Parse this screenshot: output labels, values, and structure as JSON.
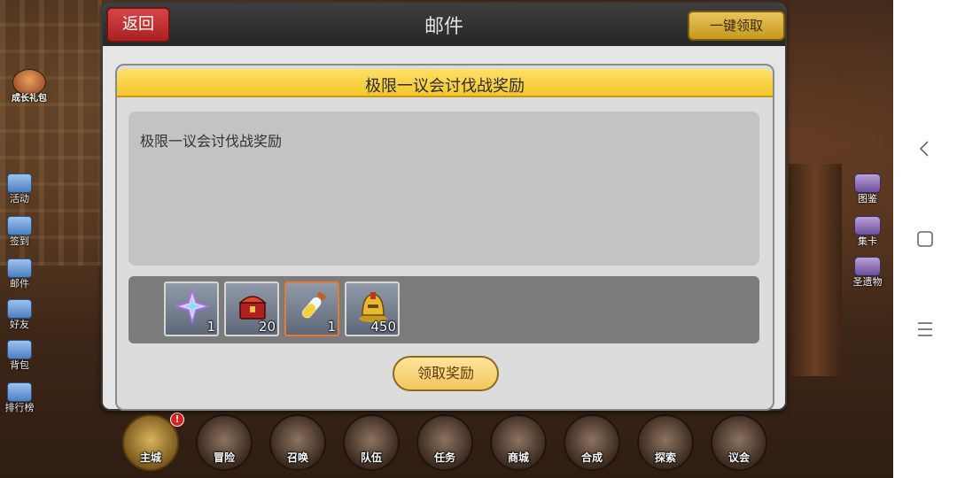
{
  "mail": {
    "title": "邮件",
    "back_label": "返回",
    "claim_all_label": "一键领取",
    "detail": {
      "title": "极限一议会讨伐战奖励",
      "body": "极限一议会讨伐战奖励",
      "rewards": [
        {
          "icon": "star-crystal-icon",
          "quantity": "1"
        },
        {
          "icon": "treasure-chest-icon",
          "quantity": "20"
        },
        {
          "icon": "potion-vial-icon",
          "quantity": "1"
        },
        {
          "icon": "gold-helmet-icon",
          "quantity": "450"
        }
      ],
      "claim_label": "领取奖励"
    }
  },
  "left_menu": {
    "growth_pack": "成长礼包",
    "items": [
      {
        "label": "活动",
        "icon": "flag-icon"
      },
      {
        "label": "签到",
        "icon": "calendar-check-icon"
      },
      {
        "label": "邮件",
        "icon": "envelope-icon"
      },
      {
        "label": "好友",
        "icon": "friends-icon"
      },
      {
        "label": "背包",
        "icon": "backpack-icon"
      },
      {
        "label": "排行榜",
        "icon": "bar-chart-icon"
      }
    ]
  },
  "right_menu": {
    "items": [
      {
        "label": "图鉴",
        "icon": "book-icon"
      },
      {
        "label": "集卡",
        "icon": "card-icon"
      },
      {
        "label": "圣遗物",
        "icon": "relic-icon"
      }
    ]
  },
  "bottom_nav": {
    "badge": "!",
    "items": [
      {
        "label": "主城",
        "active": true
      },
      {
        "label": "冒险",
        "active": false
      },
      {
        "label": "召唤",
        "active": false
      },
      {
        "label": "队伍",
        "active": false
      },
      {
        "label": "任务",
        "active": false
      },
      {
        "label": "商城",
        "active": false
      },
      {
        "label": "合成",
        "active": false
      },
      {
        "label": "探索",
        "active": false
      },
      {
        "label": "议会",
        "active": false
      }
    ]
  },
  "colors": {
    "back_button": "#c83232",
    "claim_all_button": "#d9ad3a",
    "banner": "#f8d548",
    "reward_highlight": "#e67a3a"
  }
}
